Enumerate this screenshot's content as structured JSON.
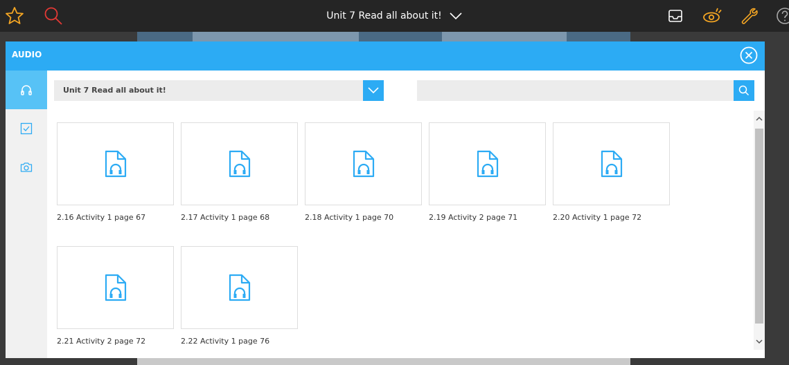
{
  "topbar": {
    "title": "Unit 7 Read all about it!",
    "icons": [
      "star-icon",
      "search-icon",
      "chevron-down-icon",
      "tray-icon",
      "eye-icon",
      "wrench-icon",
      "help-icon"
    ],
    "accent_color": "#f5a623",
    "search_color": "#e53935"
  },
  "modal": {
    "title": "AUDIO",
    "header_color": "#2cabf4",
    "sidebar": [
      {
        "icon": "headphones-icon",
        "active": true
      },
      {
        "icon": "checkbox-icon",
        "active": false
      },
      {
        "icon": "camera-icon",
        "active": false
      }
    ],
    "dropdown": {
      "selected": "Unit 7 Read all about it!"
    },
    "search": {
      "value": "",
      "placeholder": ""
    },
    "items": [
      {
        "label": "2.16 Activity 1 page 67",
        "icon": "audio-file-icon"
      },
      {
        "label": "2.17 Activity 1 page 68",
        "icon": "audio-file-icon"
      },
      {
        "label": "2.18 Activity 1 page 70",
        "icon": "audio-file-icon"
      },
      {
        "label": "2.19 Activity 2 page 71",
        "icon": "audio-file-icon"
      },
      {
        "label": "2.20 Activity 1 page 72",
        "icon": "audio-file-icon"
      },
      {
        "label": "2.21 Activity 2 page 72",
        "icon": "audio-file-icon"
      },
      {
        "label": "2.22 Activity 1 page 76",
        "icon": "audio-file-icon"
      }
    ]
  }
}
